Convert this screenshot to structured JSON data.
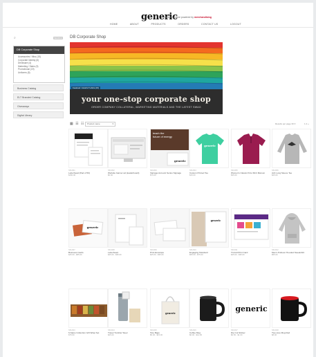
{
  "header": {
    "logo": "generic",
    "tagline_prefix": "company store powered by",
    "tagline_brand": "merchandising",
    "nav": [
      "HOME",
      "ABOUT",
      "PRODUCTS",
      "ORDERS",
      "CONTACT US",
      "LOGOUT"
    ]
  },
  "sidebar": {
    "search_placeholder": "",
    "search_button": "SEARCH",
    "active_section": "DB Corporate Shop",
    "categories": [
      "Accessories / Misc (15)",
      "Corporate Identity (6)",
      "Drinkware (4)",
      "Marketing / Sales (9)",
      "Promotional (19)",
      "Uniforms (8)"
    ],
    "menu": [
      "Business Catalog",
      "ELT Branded Catalog",
      "Giveaways",
      "Digital Library"
    ]
  },
  "main": {
    "title": "DB Corporate Shop",
    "banner": {
      "caption": "Featured: Colorful T-shirts (15)",
      "title": "your one-stop corporate shop",
      "subtitle": "ORDER COMPANY COLLATERAL, MARKETING MATERIALS AND THE LATEST SWAG"
    },
    "toolbar": {
      "view_icons": "▦ ☰ ☷",
      "sort_label": "Product name",
      "results_per_page": "Results per page",
      "per_page": "36",
      "pager": "1  2  »"
    },
    "products": [
      {
        "sku": "SKU001",
        "name": "Letterhead (Pad of 50)",
        "price": "$150.00"
      },
      {
        "sku": "SKU002",
        "name": "Website banner ad (leaderboard)",
        "price": "$0.00"
      },
      {
        "sku": "SKU003",
        "name": "Vantage Account Series Signage",
        "price": "$75.00"
      },
      {
        "sku": "SKU004",
        "name": "Custom Printed Tee",
        "price": "$15.00"
      },
      {
        "sku": "SKU005",
        "name": "Women's Classic Polo Shirt Maroon",
        "price": "$35.00"
      },
      {
        "sku": "SKU006",
        "name": "Ash Long Sleeve Tee",
        "price": "$25.00"
      },
      {
        "sku": "SKU007",
        "name": "Business Cards",
        "price": "$45.00 - $85.00"
      },
      {
        "sku": "SKU008",
        "name": "Letterhead",
        "price": "$45.00 - $95.00"
      },
      {
        "sku": "SKU009",
        "name": "Print Envelope",
        "price": "$45.00 - $95.00"
      },
      {
        "sku": "SKU010",
        "name": "Engaging Standard",
        "price": "$55.00 - $75.00"
      },
      {
        "sku": "SKU011",
        "name": "Tri-fold Print Card",
        "price": "$45.00 - $95.00"
      },
      {
        "sku": "SKU012",
        "name": "Men's Pullover Hooded Sweatshirt",
        "price": "$55.00"
      },
      {
        "sku": "SKU013",
        "name": "6-Spice Collection Gift Wrap Set",
        "price": "$75.00"
      },
      {
        "sku": "SKU014",
        "name": "Travel Tumbler Steel",
        "price": "$25.00"
      },
      {
        "sku": "SKU015",
        "name": "Tote Bags",
        "price": "$5.00 - $15.00"
      },
      {
        "sku": "SKU016",
        "name": "Coffee Mug",
        "price": "$6.00 - $12.00"
      },
      {
        "sku": "SKU017",
        "name": "Die Cut Sticker",
        "price": "$0.50 - $1.00"
      },
      {
        "sku": "SKU018",
        "name": "Two-tone Mug Red",
        "price": "$8.00"
      }
    ],
    "feature_panel": {
      "line1": "teach the",
      "line2": "future of energy"
    },
    "product_logo_text": "generic"
  },
  "colors": {
    "accent_red": "#c8102e",
    "sidebar_header": "#444444",
    "teal_shirt": "#3ecfa0",
    "maroon_polo": "#9a1c4f",
    "banner_dark": "#2d2d2d"
  }
}
